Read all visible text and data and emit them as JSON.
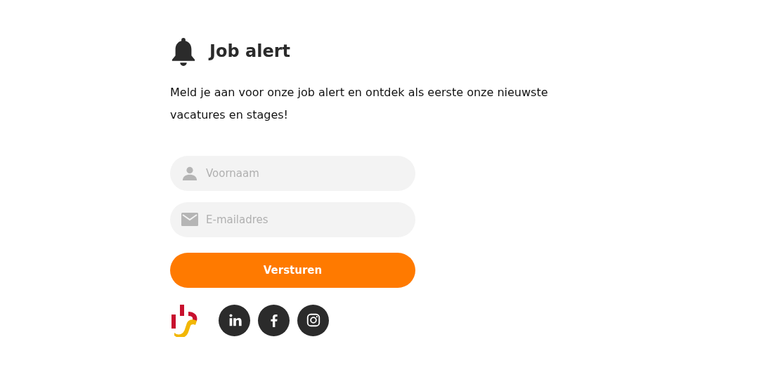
{
  "title": "Job alert",
  "intro": "Meld je aan voor onze job alert en ontdek als eerste onze nieuwste vacatures en stages!",
  "fields": [
    {
      "kind": "name",
      "placeholder": "Voornaam"
    },
    {
      "kind": "email",
      "placeholder": "E-mailadres"
    }
  ],
  "submit": "Versturen",
  "social": [
    {
      "kind": "linkedin"
    },
    {
      "kind": "facebook"
    },
    {
      "kind": "instagram"
    }
  ]
}
